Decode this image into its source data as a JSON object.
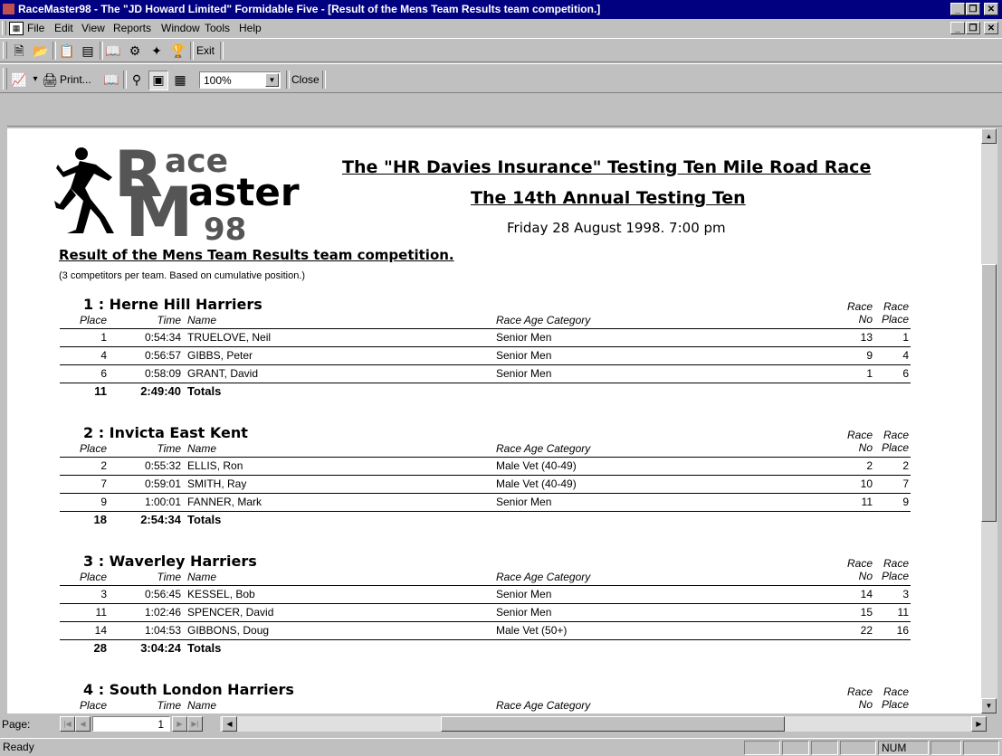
{
  "window": {
    "title": "RaceMaster98 - The \"JD Howard Limited\" Formidable Five - [Result of the Mens Team Results team competition.]"
  },
  "menu": [
    "File",
    "Edit",
    "View",
    "Reports",
    "Window",
    "Tools",
    "Help"
  ],
  "toolbar1": {
    "exit_label": "Exit"
  },
  "toolbar2": {
    "print_label": "Print...",
    "zoom_value": "100%",
    "close_label": "Close"
  },
  "report": {
    "logo": {
      "l1": "ace",
      "l2": "aster",
      "l3": "98",
      "big_r": "R",
      "big_m": "M"
    },
    "race_title": "The \"HR Davies Insurance\" Testing Ten Mile Road Race",
    "race_subtitle": "The 14th Annual Testing Ten",
    "race_date": "Friday 28 August 1998. 7:00 pm",
    "result_title": "Result of the Mens Team Results team competition.",
    "note": "(3 competitors per team. Based on cumulative position.)",
    "col_place": "Place",
    "col_time": "Time",
    "col_name": "Name",
    "col_category": "Race Age Category",
    "col_race": "Race",
    "col_no": "No",
    "col_raceplace": "Place",
    "totals_label": "Totals",
    "teams": [
      {
        "heading": "1 :  Herne Hill Harriers",
        "total_place": "11",
        "total_time": "2:49:40",
        "rows": [
          {
            "place": "1",
            "time": "0:54:34",
            "name": "TRUELOVE, Neil",
            "category": "Senior Men",
            "raceno": "13",
            "raceplace": "1"
          },
          {
            "place": "4",
            "time": "0:56:57",
            "name": "GIBBS, Peter",
            "category": "Senior Men",
            "raceno": "9",
            "raceplace": "4"
          },
          {
            "place": "6",
            "time": "0:58:09",
            "name": "GRANT, David",
            "category": "Senior Men",
            "raceno": "1",
            "raceplace": "6"
          }
        ]
      },
      {
        "heading": "2 :  Invicta East Kent",
        "total_place": "18",
        "total_time": "2:54:34",
        "rows": [
          {
            "place": "2",
            "time": "0:55:32",
            "name": "ELLIS, Ron",
            "category": "Male Vet (40-49)",
            "raceno": "2",
            "raceplace": "2"
          },
          {
            "place": "7",
            "time": "0:59:01",
            "name": "SMITH, Ray",
            "category": "Male Vet (40-49)",
            "raceno": "10",
            "raceplace": "7"
          },
          {
            "place": "9",
            "time": "1:00:01",
            "name": "FANNER, Mark",
            "category": "Senior Men",
            "raceno": "11",
            "raceplace": "9"
          }
        ]
      },
      {
        "heading": "3 :  Waverley Harriers",
        "total_place": "28",
        "total_time": "3:04:24",
        "rows": [
          {
            "place": "3",
            "time": "0:56:45",
            "name": "KESSEL, Bob",
            "category": "Senior Men",
            "raceno": "14",
            "raceplace": "3"
          },
          {
            "place": "11",
            "time": "1:02:46",
            "name": "SPENCER, David",
            "category": "Senior Men",
            "raceno": "15",
            "raceplace": "11"
          },
          {
            "place": "14",
            "time": "1:04:53",
            "name": "GIBBONS, Doug",
            "category": "Male Vet (50+)",
            "raceno": "22",
            "raceplace": "16"
          }
        ]
      },
      {
        "heading": "4 :  South London Harriers",
        "total_place": "",
        "total_time": "",
        "rows": []
      }
    ]
  },
  "pager": {
    "label": "Page:",
    "value": "1"
  },
  "status": {
    "text": "Ready",
    "num": "NUM"
  }
}
